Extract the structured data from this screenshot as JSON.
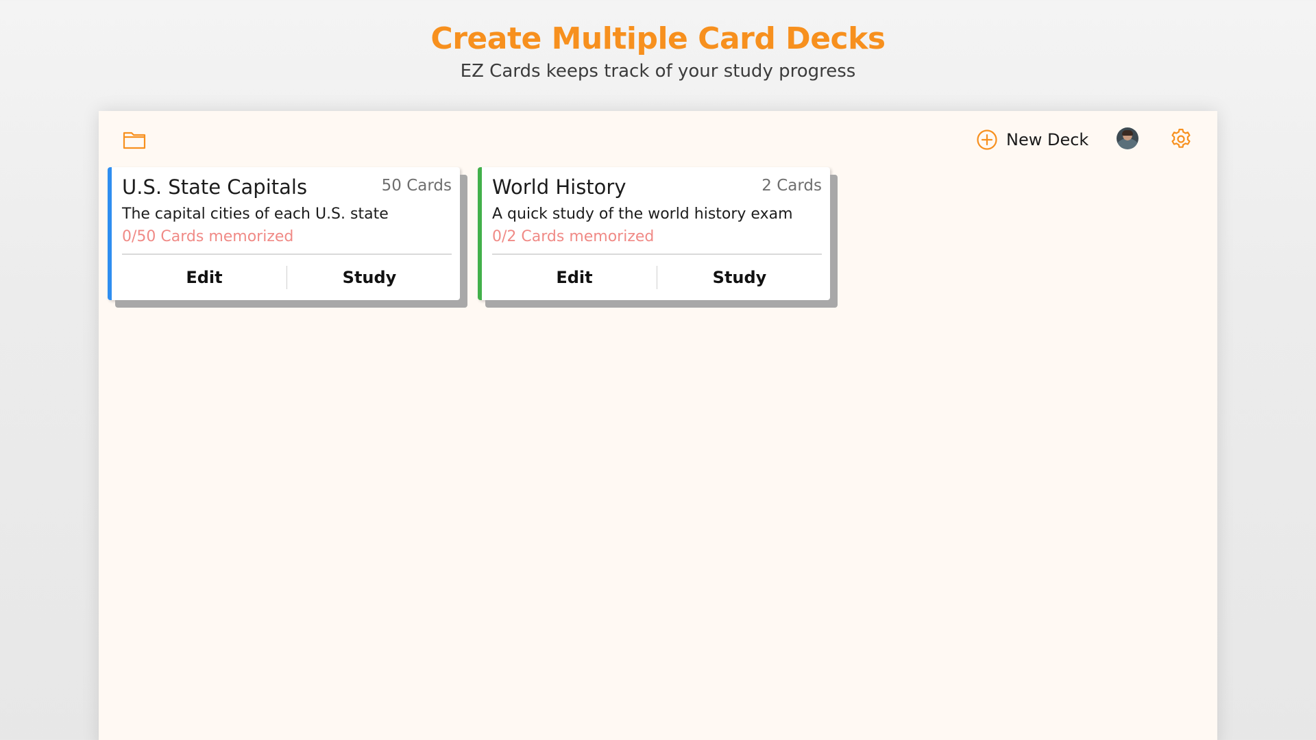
{
  "promo": {
    "headline": "Create Multiple Card Decks",
    "subheadline": "EZ Cards keeps track of your study progress"
  },
  "toolbar": {
    "folder_icon": "folder-icon",
    "new_deck_icon": "plus-circle-icon",
    "new_deck_label": "New Deck",
    "settings_icon": "gear-icon",
    "accent_color": "#f7901e"
  },
  "decks": [
    {
      "title": "U.S. State Capitals",
      "count": "50 Cards",
      "description": "The capital cities of each U.S. state",
      "progress": "0/50 Cards memorized",
      "edit_label": "Edit",
      "study_label": "Study",
      "accent_color": "#2f8ef0"
    },
    {
      "title": "World History",
      "count": "2 Cards",
      "description": "A quick study of the world history exam",
      "progress": "0/2 Cards memorized",
      "edit_label": "Edit",
      "study_label": "Study",
      "accent_color": "#42b04a"
    }
  ]
}
